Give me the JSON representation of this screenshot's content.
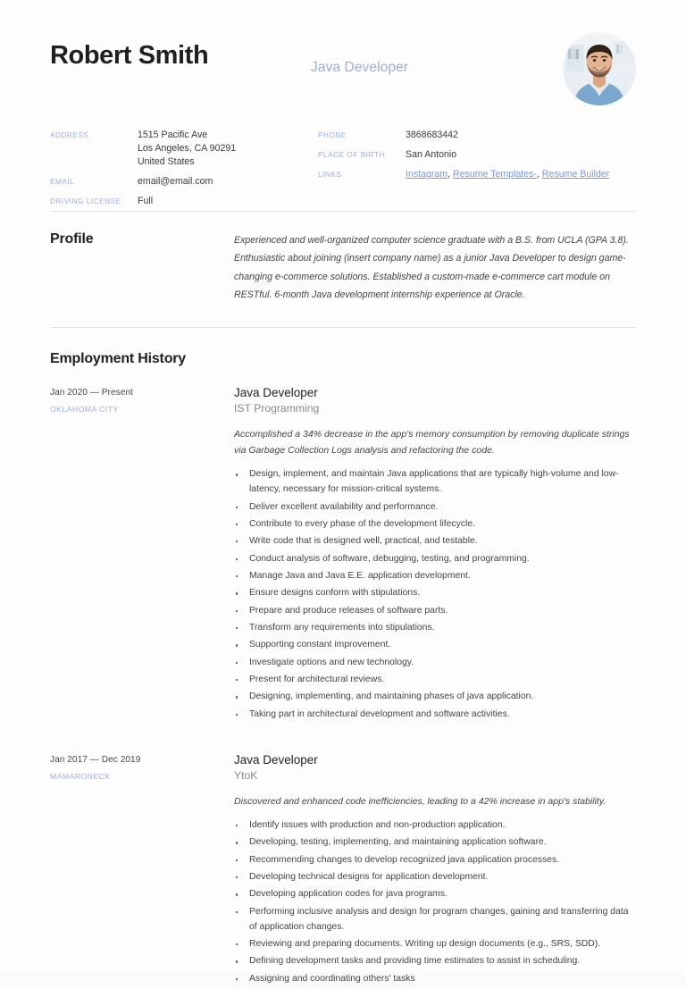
{
  "header": {
    "name": "Robert Smith",
    "job_title": "Java Developer",
    "avatar_alt": "profile-photo"
  },
  "contact": {
    "left": [
      {
        "label": "ADDRESS",
        "lines": [
          "1515 Pacific Ave",
          "Los Angeles, CA 90291",
          "United States"
        ]
      },
      {
        "label": "EMAIL",
        "lines": [
          "email@email.com"
        ]
      },
      {
        "label": "DRIVING LICENSE",
        "lines": [
          "Full"
        ]
      }
    ],
    "right": [
      {
        "label": "PHONE",
        "lines": [
          "3868683442"
        ]
      },
      {
        "label": "PLACE OF BIRTH",
        "lines": [
          "San Antonio"
        ]
      }
    ],
    "links_label": "LINKS",
    "links": [
      "Instagram",
      "Resume Templates-",
      "Resume Builder"
    ],
    "links_separator": ", "
  },
  "profile": {
    "heading": "Profile",
    "text": "Experienced and well-organized computer science graduate with a B.S. from UCLA (GPA 3.8). Enthusiastic about joining (insert company name) as a junior Java Developer to design game-changing e-commerce solutions. Established a custom-made e-commerce cart module on RESTful. 6-month Java development internship experience at Oracle."
  },
  "employment": {
    "heading": "Employment History",
    "jobs": [
      {
        "dates": "Jan 2020 — Present",
        "city": "OKLAHOMA CITY",
        "role": "Java Developer",
        "company": "IST Programming",
        "summary": "Accomplished a 34% decrease in the app's memory consumption by removing duplicate strings via Garbage Collection Logs analysis and refactoring the code.",
        "bullets": [
          "Design, implement, and maintain Java applications that are typically high-volume and low-latency, necessary for mission-critical systems.",
          "Deliver excellent availability and performance.",
          "Contribute to every phase of the development lifecycle.",
          "Write code that is designed well, practical, and testable.",
          "Conduct analysis of software, debugging, testing, and programming.",
          "Manage Java and Java E.E. application development.",
          "Ensure designs conform with stipulations.",
          "Prepare and produce releases of software parts.",
          "Transform any requirements into stipulations.",
          "Supporting constant improvement.",
          "Investigate options and new technology.",
          "Present for architectural reviews.",
          "Designing, implementing, and maintaining phases of java application.",
          "Taking part in architectural development and software activities."
        ]
      },
      {
        "dates": "Jan 2017 — Dec 2019",
        "city": "MAMARONECK",
        "role": "Java Developer",
        "company": "YtoK",
        "summary": "Discovered and enhanced code inefficiencies, leading to a 42% increase in app's stability.",
        "bullets": [
          "Identify issues with production and non-production application.",
          "Developing, testing, implementing, and maintaining application software.",
          "Recommending changes to develop recognized java application processes.",
          "Developing technical designs for application development.",
          "Developing application codes for java programs.",
          "Performing inclusive analysis and design for program changes, gaining and transferring data of application changes.",
          "Reviewing and preparing documents. Writing up design documents (e.g., SRS, SDD).",
          "Defining development tasks and providing time estimates to assist in scheduling.",
          "Assigning and coordinating others' tasks"
        ]
      }
    ]
  },
  "colors": {
    "accent": "#9bb0d6",
    "link": "#7d9ad6",
    "heading": "#1f1f1f",
    "body": "#444444",
    "muted": "#8a8a8a",
    "divider": "#e6e6e6",
    "page_background": "#fdfdfd"
  }
}
